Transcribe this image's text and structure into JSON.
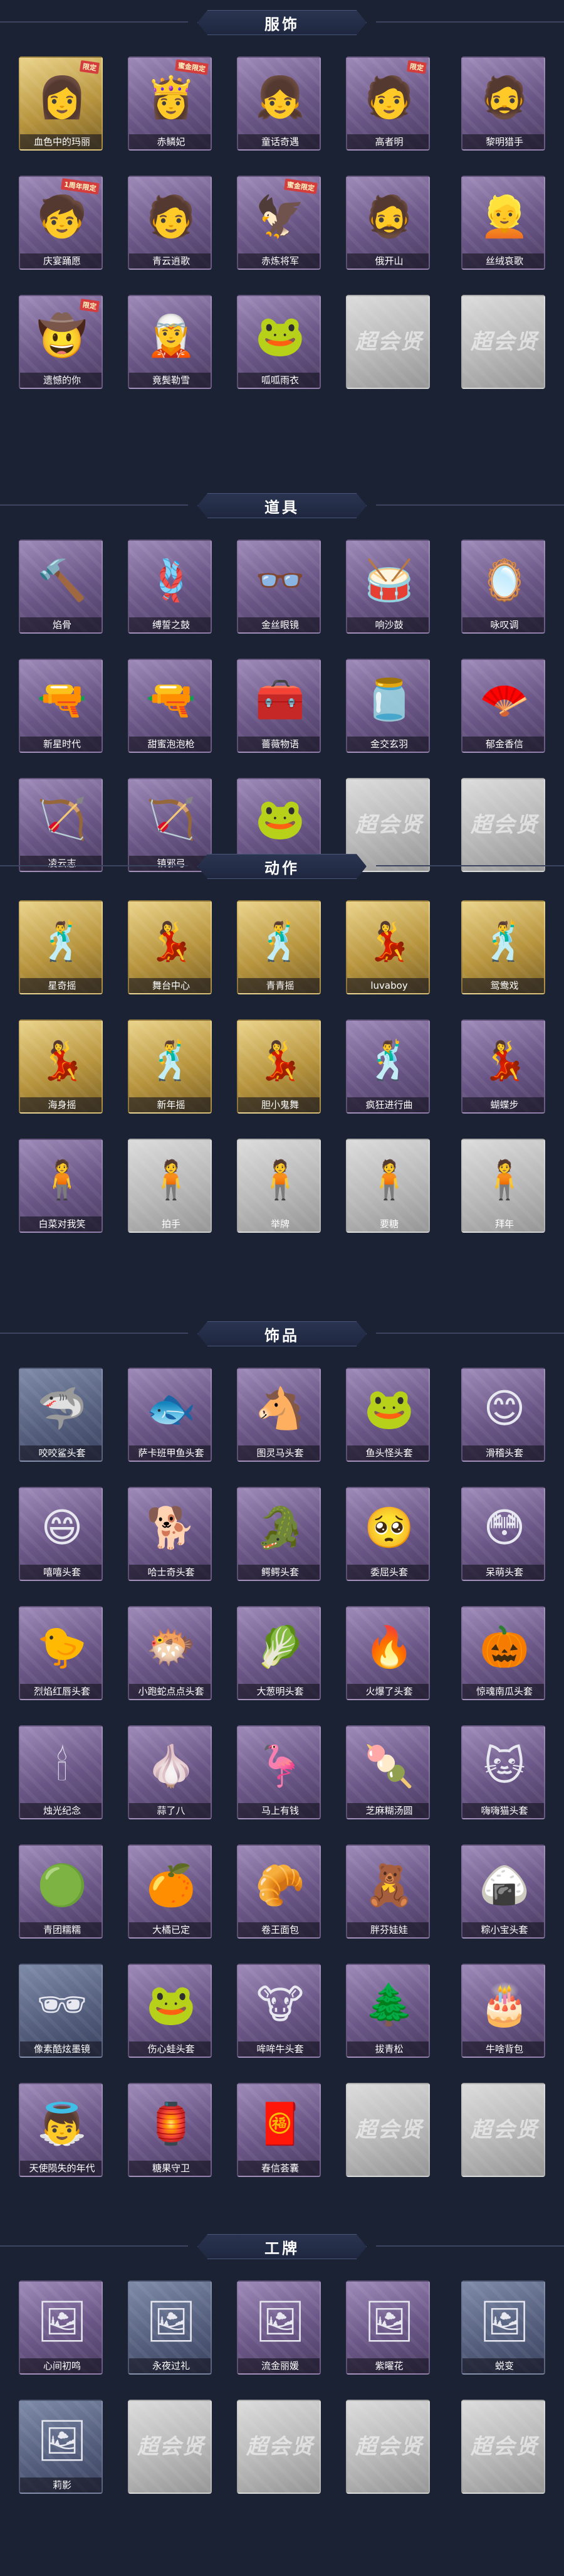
{
  "sections": [
    {
      "title": "服饰",
      "items": [
        {
          "label": "血色中的玛丽",
          "style": "gold",
          "icon": "👩",
          "icon_name": "character-portrait-icon",
          "tag": "限定"
        },
        {
          "label": "赤鳞妃",
          "style": "purple",
          "icon": "👸",
          "icon_name": "character-portrait-icon",
          "tag": "蜜金限定"
        },
        {
          "label": "童话奇遇",
          "style": "purple",
          "icon": "👧",
          "icon_name": "character-portrait-icon",
          "tag": ""
        },
        {
          "label": "高者明",
          "style": "purple",
          "icon": "🧑",
          "icon_name": "character-portrait-icon",
          "tag": "限定"
        },
        {
          "label": "黎明猎手",
          "style": "purple",
          "icon": "🧔",
          "icon_name": "character-portrait-icon",
          "tag": ""
        },
        {
          "label": "庆宴踊愿",
          "style": "purple",
          "icon": "🧒",
          "icon_name": "character-portrait-icon",
          "tag": "1周年限定"
        },
        {
          "label": "青云逍歌",
          "style": "purple",
          "icon": "🧑",
          "icon_name": "character-portrait-icon",
          "tag": ""
        },
        {
          "label": "赤炼将军",
          "style": "purple",
          "icon": "🦅",
          "icon_name": "character-portrait-icon",
          "tag": "蜜金限定"
        },
        {
          "label": "俄开山",
          "style": "purple",
          "icon": "🧔",
          "icon_name": "character-portrait-icon",
          "tag": ""
        },
        {
          "label": "丝绒哀歌",
          "style": "purple",
          "icon": "👱",
          "icon_name": "character-portrait-icon",
          "tag": ""
        },
        {
          "label": "遗憾的你",
          "style": "purple",
          "icon": "🤠",
          "icon_name": "character-portrait-icon",
          "tag": "限定"
        },
        {
          "label": "竟鬓勒雪",
          "style": "purple",
          "icon": "🧝",
          "icon_name": "character-portrait-icon",
          "tag": ""
        },
        {
          "label": "呱呱雨衣",
          "style": "purple",
          "icon": "🐸",
          "icon_name": "character-portrait-icon",
          "tag": ""
        },
        {
          "label": "",
          "style": "grey",
          "icon": "",
          "icon_name": "placeholder-icon",
          "tag": "",
          "watermark": "超会贤"
        },
        {
          "label": "",
          "style": "grey",
          "icon": "",
          "icon_name": "placeholder-icon",
          "tag": "",
          "watermark": "超会贤"
        }
      ]
    },
    {
      "title": "道具",
      "items": [
        {
          "label": "焰骨",
          "style": "purple",
          "icon": "🔨",
          "icon_name": "tool-icon",
          "tag": ""
        },
        {
          "label": "缚誓之鼓",
          "style": "purple",
          "icon": "🪢",
          "icon_name": "tool-icon",
          "tag": ""
        },
        {
          "label": "金丝眼镜",
          "style": "purple",
          "icon": "👓",
          "icon_name": "glasses-icon",
          "tag": ""
        },
        {
          "label": "响沙鼓",
          "style": "purple",
          "icon": "🥁",
          "icon_name": "drum-icon",
          "tag": ""
        },
        {
          "label": "咏叹调",
          "style": "purple",
          "icon": "🪞",
          "icon_name": "tool-icon",
          "tag": ""
        },
        {
          "label": "新星时代",
          "style": "purple",
          "icon": "🔫",
          "icon_name": "gun-icon",
          "tag": ""
        },
        {
          "label": "甜蜜泡泡枪",
          "style": "purple",
          "icon": "🔫",
          "icon_name": "gun-icon",
          "tag": ""
        },
        {
          "label": "薔薇物语",
          "style": "purple",
          "icon": "🧰",
          "icon_name": "case-icon",
          "tag": ""
        },
        {
          "label": "金交玄羽",
          "style": "purple",
          "icon": "🫙",
          "icon_name": "tool-icon",
          "tag": ""
        },
        {
          "label": "郁金香信",
          "style": "purple",
          "icon": "🪭",
          "icon_name": "fan-icon",
          "tag": ""
        },
        {
          "label": "凌云志",
          "style": "purple",
          "icon": "🏹",
          "icon_name": "bow-icon",
          "tag": ""
        },
        {
          "label": "镇邪弓",
          "style": "purple",
          "icon": "🏹",
          "icon_name": "bow-icon",
          "tag": ""
        },
        {
          "label": "青蛙小夜曲",
          "style": "purple",
          "icon": "🐸",
          "icon_name": "frog-icon",
          "tag": ""
        },
        {
          "label": "",
          "style": "grey",
          "icon": "",
          "icon_name": "placeholder-icon",
          "tag": "",
          "watermark": "超会贤"
        },
        {
          "label": "",
          "style": "grey",
          "icon": "",
          "icon_name": "placeholder-icon",
          "tag": "",
          "watermark": "超会贤"
        }
      ]
    },
    {
      "title": "动作",
      "items": [
        {
          "label": "星奇摇",
          "style": "gold",
          "icon": "🕺",
          "icon_name": "pose-icon",
          "tag": ""
        },
        {
          "label": "舞台中心",
          "style": "gold",
          "icon": "💃",
          "icon_name": "pose-icon",
          "tag": ""
        },
        {
          "label": "青青摇",
          "style": "gold",
          "icon": "🕺",
          "icon_name": "pose-icon",
          "tag": ""
        },
        {
          "label": "luvaboy",
          "style": "gold",
          "icon": "💃",
          "icon_name": "pose-icon",
          "tag": ""
        },
        {
          "label": "鸳鸯戏",
          "style": "gold",
          "icon": "🕺",
          "icon_name": "pose-icon",
          "tag": ""
        },
        {
          "label": "海身摇",
          "style": "gold",
          "icon": "💃",
          "icon_name": "pose-icon",
          "tag": ""
        },
        {
          "label": "新年摇",
          "style": "gold",
          "icon": "🕺",
          "icon_name": "pose-icon",
          "tag": ""
        },
        {
          "label": "胆小鬼舞",
          "style": "gold",
          "icon": "💃",
          "icon_name": "pose-icon",
          "tag": ""
        },
        {
          "label": "疯狂进行曲",
          "style": "purple",
          "icon": "🕺",
          "icon_name": "pose-icon",
          "tag": ""
        },
        {
          "label": "蝴蝶步",
          "style": "purple",
          "icon": "💃",
          "icon_name": "pose-icon",
          "tag": ""
        },
        {
          "label": "白菜对我笑",
          "style": "purple",
          "icon": "🧍",
          "icon_name": "pose-icon",
          "tag": ""
        },
        {
          "label": "拍手",
          "style": "grey",
          "icon": "🧍",
          "icon_name": "pose-icon",
          "tag": ""
        },
        {
          "label": "举牌",
          "style": "grey",
          "icon": "🧍",
          "icon_name": "pose-icon",
          "tag": ""
        },
        {
          "label": "要糖",
          "style": "grey",
          "icon": "🧍",
          "icon_name": "pose-icon",
          "tag": ""
        },
        {
          "label": "拜年",
          "style": "grey",
          "icon": "🧍",
          "icon_name": "pose-icon",
          "tag": ""
        }
      ]
    },
    {
      "title": "饰品",
      "items": [
        {
          "label": "咬咬鲨头套",
          "style": "blue",
          "icon": "🦈",
          "icon_name": "shark-head-icon",
          "tag": ""
        },
        {
          "label": "萨卡班甲鱼头套",
          "style": "purple",
          "icon": "🐟",
          "icon_name": "fish-head-icon",
          "tag": ""
        },
        {
          "label": "图灵马头套",
          "style": "purple",
          "icon": "🐴",
          "icon_name": "horse-head-icon",
          "tag": ""
        },
        {
          "label": "鱼头怪头套",
          "style": "purple",
          "icon": "🐸",
          "icon_name": "fish-monster-head-icon",
          "tag": ""
        },
        {
          "label": "滑稽头套",
          "style": "purple",
          "icon": "😊",
          "icon_name": "smiley-head-icon",
          "tag": ""
        },
        {
          "label": "嘻嘻头套",
          "style": "purple",
          "icon": "😄",
          "icon_name": "grin-head-icon",
          "tag": ""
        },
        {
          "label": "哈士奇头套",
          "style": "purple",
          "icon": "🐕",
          "icon_name": "husky-head-icon",
          "tag": ""
        },
        {
          "label": "鳄鳄头套",
          "style": "purple",
          "icon": "🐊",
          "icon_name": "crocodile-head-icon",
          "tag": ""
        },
        {
          "label": "委屈头套",
          "style": "purple",
          "icon": "🥺",
          "icon_name": "sad-head-icon",
          "tag": ""
        },
        {
          "label": "呆萌头套",
          "style": "purple",
          "icon": "😳",
          "icon_name": "silly-head-icon",
          "tag": ""
        },
        {
          "label": "烈焰红唇头套",
          "style": "purple",
          "icon": "🐤",
          "icon_name": "duck-head-icon",
          "tag": ""
        },
        {
          "label": "小跑蛇点点头套",
          "style": "purple",
          "icon": "🐡",
          "icon_name": "puffer-head-icon",
          "tag": ""
        },
        {
          "label": "大葱明头套",
          "style": "purple",
          "icon": "🥬",
          "icon_name": "scallion-head-icon",
          "tag": ""
        },
        {
          "label": "火爆了头套",
          "style": "purple",
          "icon": "🔥",
          "icon_name": "flame-head-icon",
          "tag": ""
        },
        {
          "label": "惊魂南瓜头套",
          "style": "purple",
          "icon": "🎃",
          "icon_name": "pumpkin-head-icon",
          "tag": ""
        },
        {
          "label": "烛光纪念",
          "style": "purple",
          "icon": "🕯",
          "icon_name": "candle-icon",
          "tag": ""
        },
        {
          "label": "蒜了八",
          "style": "purple",
          "icon": "🧄",
          "icon_name": "garlic-icon",
          "tag": ""
        },
        {
          "label": "马上有钱",
          "style": "purple",
          "icon": "🦩",
          "icon_name": "bird-icon",
          "tag": ""
        },
        {
          "label": "芝麻糊汤圆",
          "style": "purple",
          "icon": "🍡",
          "icon_name": "dumpling-icon",
          "tag": ""
        },
        {
          "label": "嗨嗨猫头套",
          "style": "purple",
          "icon": "🐱",
          "icon_name": "cat-head-icon",
          "tag": ""
        },
        {
          "label": "青团糯糯",
          "style": "purple",
          "icon": "🟢",
          "icon_name": "rice-cake-icon",
          "tag": ""
        },
        {
          "label": "大橘已定",
          "style": "purple",
          "icon": "🍊",
          "icon_name": "orange-icon",
          "tag": ""
        },
        {
          "label": "卷王面包",
          "style": "purple",
          "icon": "🥐",
          "icon_name": "bread-icon",
          "tag": ""
        },
        {
          "label": "胖芬娃娃",
          "style": "purple",
          "icon": "🧸",
          "icon_name": "doll-icon",
          "tag": ""
        },
        {
          "label": "粽小宝头套",
          "style": "purple",
          "icon": "🍙",
          "icon_name": "zongzi-head-icon",
          "tag": ""
        },
        {
          "label": "像素酷炫墨镜",
          "style": "blue",
          "icon": "🕶",
          "icon_name": "pixel-sunglasses-icon",
          "tag": ""
        },
        {
          "label": "伤心蛙头套",
          "style": "purple",
          "icon": "🐸",
          "icon_name": "frog-head-icon",
          "tag": ""
        },
        {
          "label": "哞哞牛头套",
          "style": "purple",
          "icon": "🐮",
          "icon_name": "cow-head-icon",
          "tag": ""
        },
        {
          "label": "拔青松",
          "style": "purple",
          "icon": "🌲",
          "icon_name": "pine-icon",
          "tag": ""
        },
        {
          "label": "牛啥背包",
          "style": "purple",
          "icon": "🎂",
          "icon_name": "backpack-icon",
          "tag": ""
        },
        {
          "label": "天使陨失的年代",
          "style": "purple",
          "icon": "👼",
          "icon_name": "angel-icon",
          "tag": ""
        },
        {
          "label": "糖果守卫",
          "style": "purple",
          "icon": "🏮",
          "icon_name": "lantern-icon",
          "tag": ""
        },
        {
          "label": "春信荟囊",
          "style": "purple",
          "icon": "🧧",
          "icon_name": "sachet-icon",
          "tag": ""
        },
        {
          "label": "",
          "style": "grey",
          "icon": "",
          "icon_name": "placeholder-icon",
          "tag": "",
          "watermark": "超会贤"
        },
        {
          "label": "",
          "style": "grey",
          "icon": "",
          "icon_name": "placeholder-icon",
          "tag": "",
          "watermark": "超会贤"
        }
      ]
    },
    {
      "title": "工牌",
      "items": [
        {
          "label": "心间初鸣",
          "style": "purple",
          "icon": "🖼",
          "icon_name": "badge-icon",
          "tag": ""
        },
        {
          "label": "永夜过礼",
          "style": "blue",
          "icon": "🖼",
          "icon_name": "badge-icon",
          "tag": ""
        },
        {
          "label": "流金丽媛",
          "style": "purple",
          "icon": "🖼",
          "icon_name": "badge-icon",
          "tag": ""
        },
        {
          "label": "紫曜花",
          "style": "purple",
          "icon": "🖼",
          "icon_name": "badge-icon",
          "tag": ""
        },
        {
          "label": "蜕变",
          "style": "blue",
          "icon": "🖼",
          "icon_name": "badge-icon",
          "tag": ""
        },
        {
          "label": "莉影",
          "style": "blue",
          "icon": "🖼",
          "icon_name": "badge-icon",
          "tag": ""
        },
        {
          "label": "",
          "style": "grey",
          "icon": "",
          "icon_name": "placeholder-icon",
          "tag": "",
          "watermark": "超会贤"
        },
        {
          "label": "",
          "style": "grey",
          "icon": "",
          "icon_name": "placeholder-icon",
          "tag": "",
          "watermark": "超会贤"
        },
        {
          "label": "",
          "style": "grey",
          "icon": "",
          "icon_name": "placeholder-icon",
          "tag": "",
          "watermark": "超会贤"
        },
        {
          "label": "",
          "style": "grey",
          "icon": "",
          "icon_name": "placeholder-icon",
          "tag": "",
          "watermark": "超会贤"
        }
      ]
    }
  ]
}
